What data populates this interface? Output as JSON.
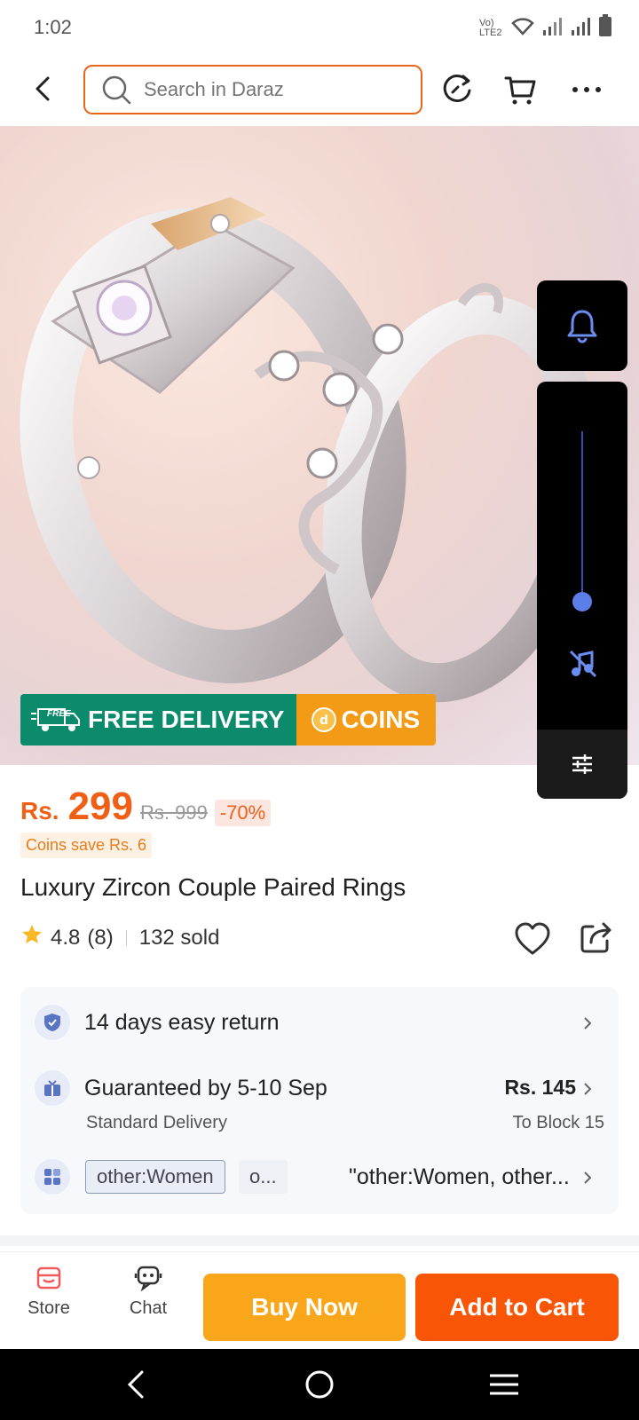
{
  "status_bar": {
    "time": "1:02",
    "network_label": "Vo) LTE2"
  },
  "header": {
    "search_placeholder": "Search in Daraz"
  },
  "promo": {
    "free_badge": "FREE",
    "free_delivery": "FREE DELIVERY",
    "coins": "COINS"
  },
  "product": {
    "currency": "Rs.",
    "price": "299",
    "original_price": "Rs. 999",
    "discount": "-70%",
    "coins_save": "Coins save Rs. 6",
    "title": "Luxury Zircon Couple Paired Rings",
    "rating": "4.8",
    "reviews": "(8)",
    "sold": "132 sold"
  },
  "services": {
    "return": "14 days easy return",
    "delivery_title": "Guaranteed by 5-10 Sep",
    "delivery_sub": "Standard Delivery",
    "delivery_price": "Rs. 145",
    "delivery_dest": "To Block 15",
    "chip1": "other:Women",
    "chip2": "o...",
    "variant_summary": "\"other:Women, other..."
  },
  "action_bar": {
    "store": "Store",
    "chat": "Chat",
    "buy_now": "Buy Now",
    "add_to_cart": "Add to Cart"
  },
  "colors": {
    "accent": "#f85606",
    "buy_now": "#faa61a",
    "free_delivery": "#0b8a6c",
    "coins": "#f39a16"
  }
}
